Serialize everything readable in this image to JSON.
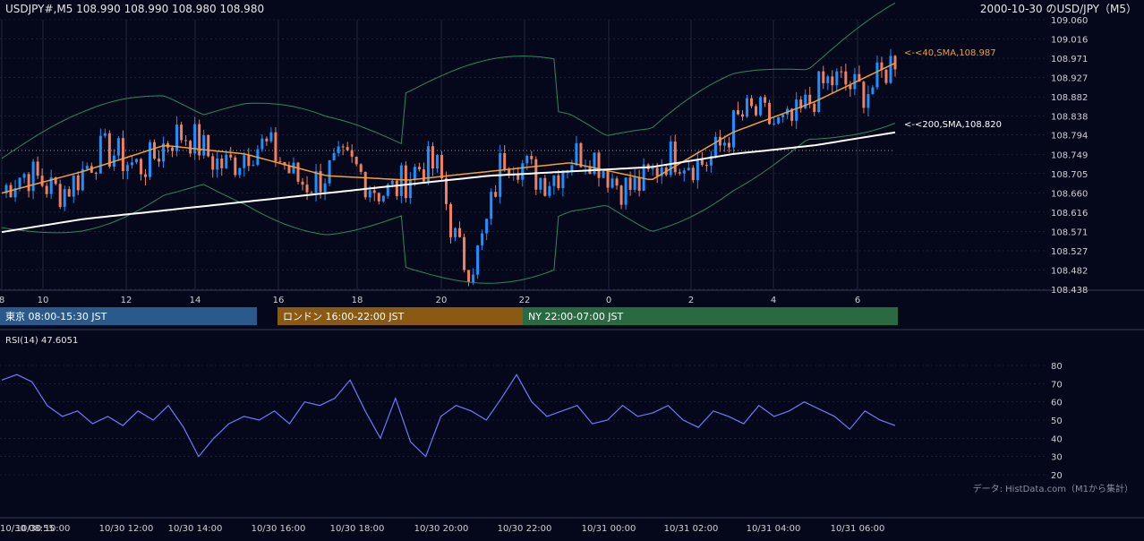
{
  "header": {
    "left_text": "USDJPY#,M5 108.990 108.990 108.980 108.980",
    "right_text": "2000-10-30 のUSD/JPY（M5）"
  },
  "main_chart": {
    "y_ticks": [
      "109.060",
      "109.016",
      "108.971",
      "108.927",
      "108.882",
      "108.838",
      "108.794",
      "108.749",
      "108.705",
      "108.660",
      "108.616",
      "108.571",
      "108.527",
      "108.482",
      "108.438"
    ],
    "x_ticks": [
      "8",
      "10",
      "12",
      "14",
      "16",
      "18",
      "20",
      "22",
      "0",
      "2",
      "4",
      "6"
    ],
    "sma40_label": "<-<40,SMA,108.987",
    "sma200_label": "<-<200,SMA,108.820",
    "colors": {
      "background": "#05071a",
      "grid": "#2a2f45",
      "up": "#1e90ff",
      "down": "#f08060",
      "sma40": "#f5a030",
      "sma200": "#ffffff",
      "bollinger": "#2e8b57"
    }
  },
  "sessions": [
    {
      "label": "東京 08:00-15:30 JST",
      "color": "#2a5a8c"
    },
    {
      "label": "ロンドン 16:00-22:00 JST",
      "color": "#8a5a14"
    },
    {
      "label": "NY 22:00-07:00 JST",
      "color": "#2a6a40"
    }
  ],
  "rsi_panel": {
    "label": "RSI(14) 47.6051",
    "y_ticks": [
      "80",
      "70",
      "60",
      "50",
      "40",
      "30",
      "20"
    ],
    "credit": "データ: HistData.com（M1から集計）",
    "line_color": "#6f79ff"
  },
  "bottom_axis": {
    "ticks": [
      "10/30 08:55",
      "10/30 10:00",
      "10/30 12:00",
      "10/30 14:00",
      "10/30 16:00",
      "10/30 18:00",
      "10/30 20:00",
      "10/30 22:00",
      "10/31 00:00",
      "10/31 02:00",
      "10/31 04:00",
      "10/31 06:00"
    ]
  },
  "chart_data": {
    "type": "line",
    "title": "2000-10-30 のUSD/JPY（M5）",
    "ylim": [
      108.438,
      109.06
    ],
    "series": [
      {
        "name": "SMA 40",
        "x": [
          "8",
          "10",
          "12",
          "14",
          "16",
          "18",
          "20",
          "22",
          "0",
          "2",
          "4",
          "6"
        ],
        "values": [
          108.66,
          108.71,
          108.77,
          108.75,
          108.7,
          108.69,
          108.71,
          108.73,
          108.69,
          108.8,
          108.87,
          108.96
        ]
      },
      {
        "name": "SMA 200",
        "x": [
          "8",
          "10",
          "12",
          "14",
          "16",
          "18",
          "20",
          "22",
          "0",
          "2",
          "4",
          "6"
        ],
        "values": [
          108.57,
          108.6,
          108.62,
          108.64,
          108.66,
          108.68,
          108.7,
          108.71,
          108.72,
          108.75,
          108.77,
          108.8
        ]
      }
    ],
    "rsi": {
      "name": "RSI(14)",
      "ylim": [
        20,
        80
      ],
      "values": [
        72,
        75,
        71,
        58,
        52,
        55,
        48,
        52,
        47,
        55,
        50,
        58,
        46,
        30,
        40,
        48,
        52,
        50,
        55,
        48,
        60,
        58,
        62,
        72,
        55,
        40,
        62,
        38,
        30,
        52,
        58,
        55,
        50,
        62,
        75,
        60,
        52,
        55,
        58,
        48,
        50,
        58,
        52,
        54,
        58,
        50,
        46,
        55,
        52,
        48,
        58,
        52,
        55,
        60,
        56,
        52,
        45,
        55,
        50,
        47
      ]
    }
  }
}
